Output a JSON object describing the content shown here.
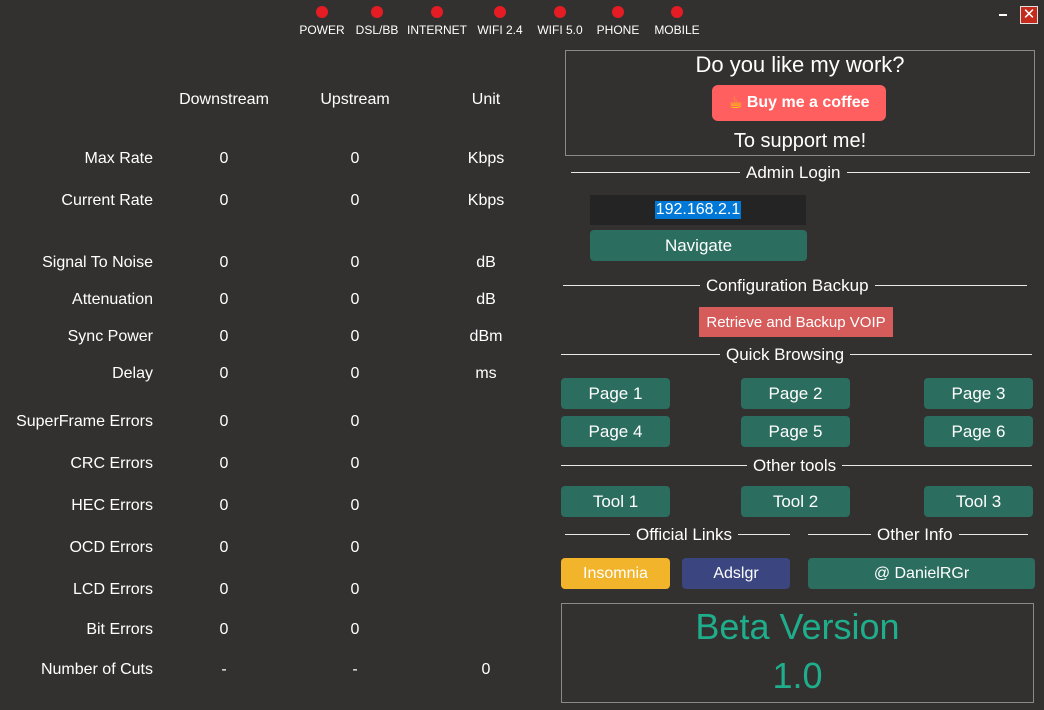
{
  "window": {
    "close_glyph": "✕",
    "minimize_glyph": ""
  },
  "leds": [
    {
      "label": "POWER",
      "color": "#e51c23"
    },
    {
      "label": "DSL/BB",
      "color": "#e51c23"
    },
    {
      "label": "INTERNET",
      "color": "#e51c23"
    },
    {
      "label": "WIFI 2.4",
      "color": "#e51c23"
    },
    {
      "label": "WIFI 5.0",
      "color": "#e51c23"
    },
    {
      "label": "PHONE",
      "color": "#e51c23"
    },
    {
      "label": "MOBILE",
      "color": "#e51c23"
    }
  ],
  "stats": {
    "headers": {
      "downstream": "Downstream",
      "upstream": "Upstream",
      "unit": "Unit"
    },
    "rows": [
      {
        "label": "Max Rate",
        "down": "0",
        "up": "0",
        "unit": "Kbps"
      },
      {
        "label": "Current Rate",
        "down": "0",
        "up": "0",
        "unit": "Kbps"
      },
      {
        "label": "Signal To Noise",
        "down": "0",
        "up": "0",
        "unit": "dB"
      },
      {
        "label": "Attenuation",
        "down": "0",
        "up": "0",
        "unit": "dB"
      },
      {
        "label": "Sync Power",
        "down": "0",
        "up": "0",
        "unit": "dBm"
      },
      {
        "label": "Delay",
        "down": "0",
        "up": "0",
        "unit": "ms"
      },
      {
        "label": "SuperFrame Errors",
        "down": "0",
        "up": "0",
        "unit": ""
      },
      {
        "label": "CRC Errors",
        "down": "0",
        "up": "0",
        "unit": ""
      },
      {
        "label": "HEC Errors",
        "down": "0",
        "up": "0",
        "unit": ""
      },
      {
        "label": "OCD Errors",
        "down": "0",
        "up": "0",
        "unit": ""
      },
      {
        "label": "LCD Errors",
        "down": "0",
        "up": "0",
        "unit": ""
      },
      {
        "label": "Bit Errors",
        "down": "0",
        "up": "0",
        "unit": ""
      },
      {
        "label": "Number of Cuts",
        "down": "-",
        "up": "-",
        "unit": "0"
      }
    ]
  },
  "support": {
    "title": "Do you like my work?",
    "coffee_label": "Buy me a coffee",
    "coffee_icon": "cup-icon",
    "subtitle": "To support me!"
  },
  "admin": {
    "section_label": "Admin Login",
    "ip_value": "192.168.2.1",
    "navigate_label": "Navigate"
  },
  "backup": {
    "section_label": "Configuration Backup",
    "button_label": "Retrieve and Backup VOIP"
  },
  "quick": {
    "section_label": "Quick Browsing",
    "pages": [
      "Page 1",
      "Page 2",
      "Page 3",
      "Page 4",
      "Page 5",
      "Page 6"
    ]
  },
  "tools": {
    "section_label": "Other tools",
    "items": [
      "Tool 1",
      "Tool 2",
      "Tool 3"
    ]
  },
  "links": {
    "official_label": "Official Links",
    "other_info_label": "Other Info",
    "insomnia": "Insomnia",
    "adslgr": "Adslgr",
    "author": "@ DanielRGr"
  },
  "version": {
    "title": "Beta Version",
    "number": "1.0"
  },
  "colors": {
    "background": "#333130",
    "accent_green": "#2b6e5f",
    "led_red": "#e51c23",
    "beta_text": "#1fae8c"
  }
}
